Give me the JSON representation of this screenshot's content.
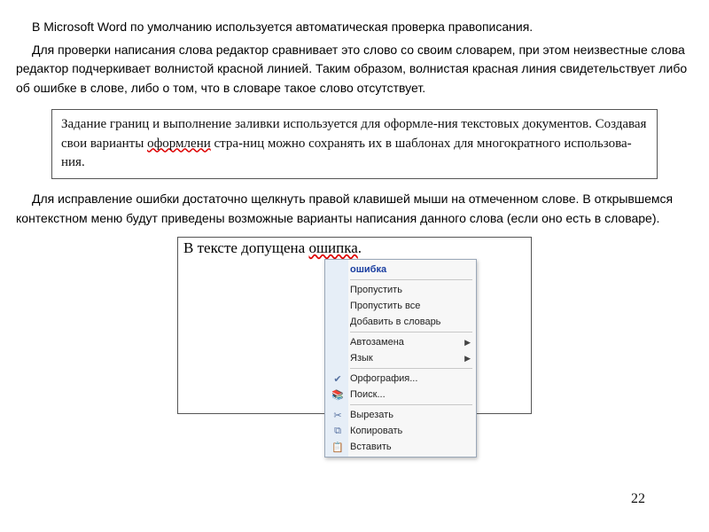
{
  "para1": "В Microsoft Word по умолчанию используется автоматическая проверка правописания.",
  "para2": "Для проверки написания слова редактор сравнивает это слово со своим словарем, при этом неизвестные слова редактор подчеркивает волнистой красной линией. Таким образом, волнистая красная линия  свидетельствует либо об ошибке в слове, либо о том, что в словаре такое слово отсутствует.",
  "box1": {
    "before": "Задание границ и выполнение заливки используется для оформле-ния текстовых документов. Создавая свои варианты ",
    "error_word": "оформлени",
    "after": " стра-ниц можно сохранять их в шаблонах для многократного использова-ния."
  },
  "para3": "Для исправление ошибки достаточно щелкнуть правой клавишей мыши на отмеченном слове. В открывшемся контекстном меню будут приведены возможные варианты написания данного слова (если оно есть в словаре).",
  "sample": {
    "before": "В тексте допущена ",
    "error_word": "ошипка",
    "after": "."
  },
  "menu": {
    "suggestion": "ошибка",
    "skip": "Пропустить",
    "skip_all": "Пропустить все",
    "add": "Добавить в словарь",
    "autocorrect": "Автозамена",
    "language": "Язык",
    "spelling": "Орфография...",
    "lookup": "Поиск...",
    "cut": "Вырезать",
    "copy": "Копировать",
    "paste": "Вставить"
  },
  "page_number": "22"
}
